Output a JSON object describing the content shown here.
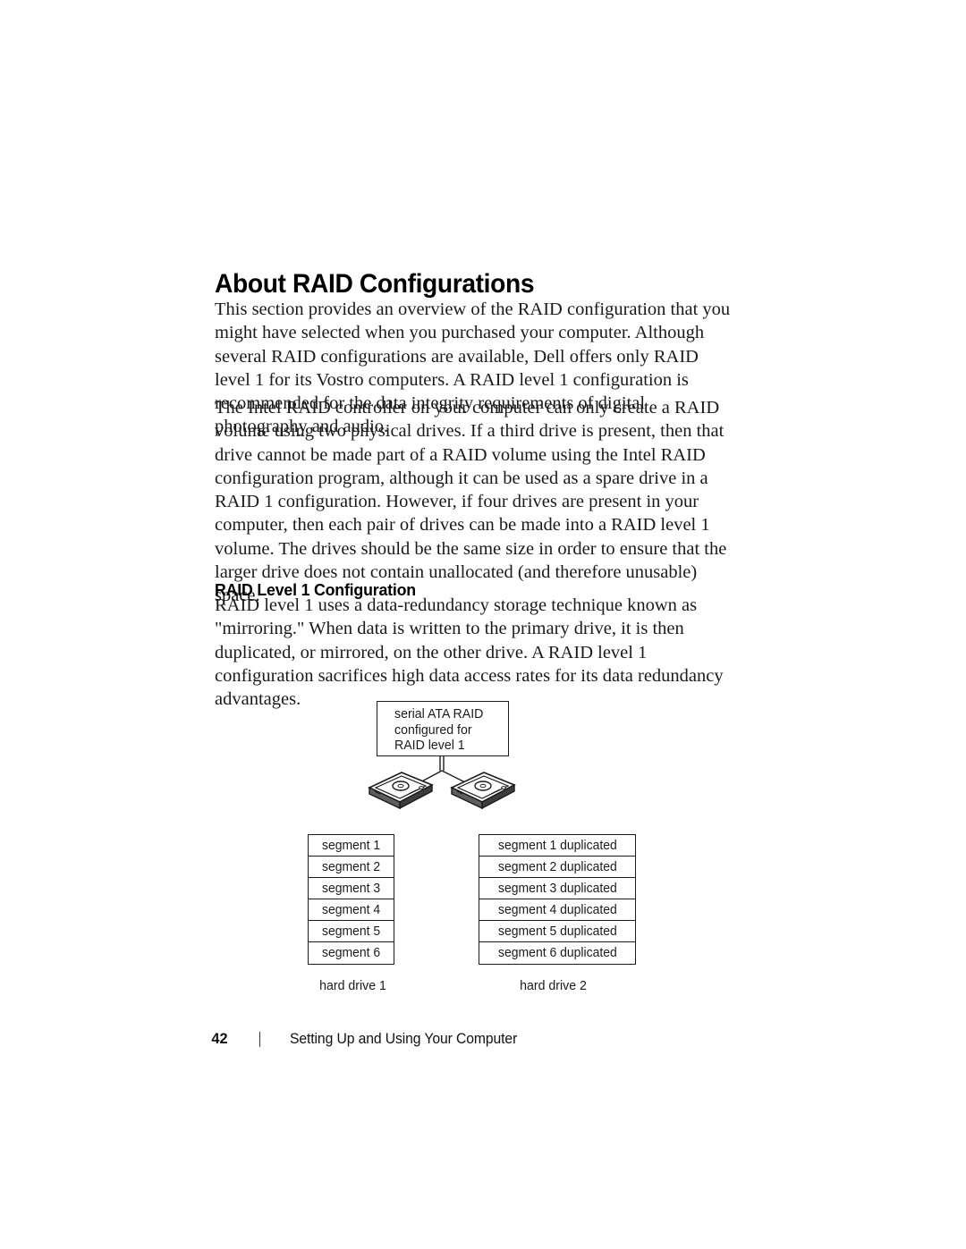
{
  "document": {
    "heading": "About RAID Configurations",
    "subheading": "RAID Level 1 Configuration",
    "paragraphs": {
      "intro": "This section provides an overview of the RAID configuration that you might have selected when you purchased your computer. Although several RAID configurations are available, Dell offers only RAID level 1 for its Vostro computers. A RAID level 1 configuration is recommended for the data integrity requirements of digital photography and audio.",
      "controller": "The Intel RAID controller on your computer can only create a RAID volume using two physical drives. If a third drive is present, then that drive cannot be made part of a RAID volume using the Intel RAID configuration program, although it can be used as a spare drive in a RAID 1 configuration. However, if four drives are present in your computer, then each pair of drives can be made into a RAID level 1 volume. The drives should be the same size in order to ensure that the larger drive does not contain unallocated (and therefore unusable) space.",
      "mirroring": "RAID level 1 uses a data-redundancy storage technique known as \"mirroring.\" When data is written to the primary drive, it is then duplicated, or mirrored, on the other drive. A RAID level 1 configuration sacrifices high data access rates for its data redundancy advantages."
    }
  },
  "diagram": {
    "callout": "serial ATA RAID\nconfigured for\nRAID level 1",
    "drive_icon_name": "hard-drive-icon",
    "left_table": {
      "rows": [
        "segment 1",
        "segment 2",
        "segment 3",
        "segment 4",
        "segment 5",
        "segment 6"
      ],
      "label": "hard drive 1"
    },
    "right_table": {
      "rows": [
        "segment 1 duplicated",
        "segment 2 duplicated",
        "segment 3 duplicated",
        "segment 4 duplicated",
        "segment 5 duplicated",
        "segment 6 duplicated"
      ],
      "label": "hard drive 2"
    }
  },
  "footer": {
    "page_number": "42",
    "section_title": "Setting Up and Using Your Computer"
  },
  "colors": {
    "text": "#1a1a1a",
    "rule": "#1b1b1b",
    "page_background": "#ffffff"
  }
}
